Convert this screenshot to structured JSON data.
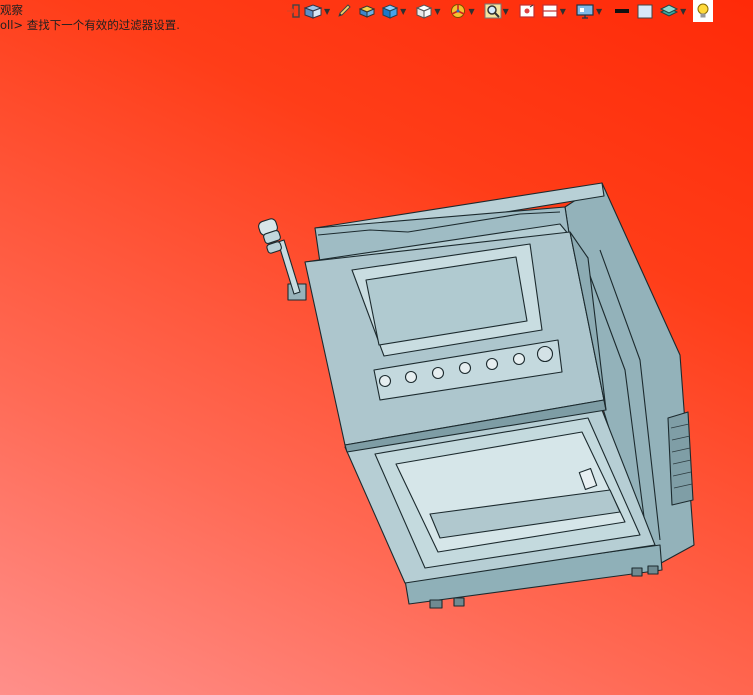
{
  "hints": {
    "line1": "观察",
    "line2": "oll> 查找下一个有效的过滤器设置."
  },
  "toolbar": {
    "items": [
      {
        "icon": "exit-icon",
        "dropdown": false
      },
      {
        "icon": "view-orientation-icon",
        "dropdown": true
      },
      {
        "icon": "pencil-icon",
        "dropdown": false
      },
      {
        "icon": "part-icon",
        "dropdown": false
      },
      {
        "icon": "display-style-icon",
        "dropdown": true
      },
      {
        "icon": "hide-show-cube-icon",
        "dropdown": true
      },
      {
        "icon": "appearance-icon",
        "dropdown": true
      },
      {
        "icon": "zoom-icon",
        "dropdown": true
      },
      {
        "icon": "section-view-icon",
        "dropdown": false
      },
      {
        "icon": "split-view-icon",
        "dropdown": true
      },
      {
        "icon": "monitor-icon",
        "dropdown": true
      },
      {
        "icon": "black-swatch-icon",
        "dropdown": false
      },
      {
        "icon": "light-swatch-icon",
        "dropdown": false
      },
      {
        "icon": "layers-icon",
        "dropdown": true
      },
      {
        "icon": "lightbulb-icon",
        "dropdown": false
      }
    ]
  },
  "colors": {
    "background_top": "#ff2a08",
    "background_bottom": "#ff8f8a",
    "model_fill": "#a7c2c9",
    "model_edge": "#1c2a2e"
  }
}
